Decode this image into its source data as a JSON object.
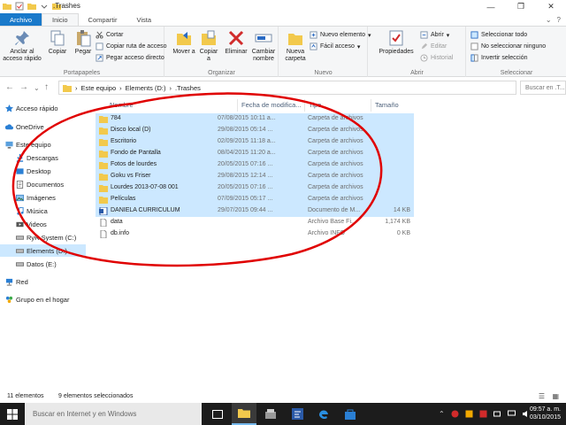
{
  "window": {
    "title": ".Trashes",
    "minimize": "—",
    "maximize": "❐",
    "close": "✕"
  },
  "tabs": [
    {
      "label": "Archivo"
    },
    {
      "label": "Inicio"
    },
    {
      "label": "Compartir"
    },
    {
      "label": "Vista"
    }
  ],
  "ribbon": {
    "clipboard": {
      "label": "Portapapeles",
      "pin": "Anclar al acceso rápido",
      "copy": "Copiar",
      "paste": "Pegar",
      "cut": "Cortar",
      "copy_path": "Copiar ruta de acceso",
      "paste_shortcut": "Pegar acceso directo"
    },
    "organize": {
      "label": "Organizar",
      "move_to": "Mover a",
      "copy_to": "Copiar a",
      "delete": "Eliminar",
      "rename": "Cambiar nombre"
    },
    "new": {
      "label": "Nuevo",
      "new_folder": "Nueva carpeta",
      "new_item": "Nuevo elemento",
      "easy_access": "Fácil acceso"
    },
    "open": {
      "label": "Abrir",
      "properties": "Propiedades",
      "open": "Abrir",
      "edit": "Editar",
      "history": "Historial"
    },
    "select": {
      "label": "Seleccionar",
      "select_all": "Seleccionar todo",
      "select_none": "No seleccionar ninguno",
      "invert": "Invertir selección"
    }
  },
  "address": {
    "crumbs": [
      "Este equipo",
      "Elements (D:)",
      ".Trashes"
    ],
    "search_placeholder": "Buscar en .T..."
  },
  "nav": [
    {
      "label": "Acceso rápido"
    },
    {
      "label": "OneDrive"
    },
    {
      "label": "Este equipo"
    },
    {
      "label": "Descargas"
    },
    {
      "label": "Desktop"
    },
    {
      "label": "Documentos"
    },
    {
      "label": "Imágenes"
    },
    {
      "label": "Música"
    },
    {
      "label": "Videos"
    },
    {
      "label": "RyR System (C:)"
    },
    {
      "label": "Elements (D:)"
    },
    {
      "label": "Datos (E:)"
    },
    {
      "label": "Red"
    },
    {
      "label": "Grupo en el hogar"
    }
  ],
  "columns": {
    "name": "Nombre",
    "date": "Fecha de modifica...",
    "type": "Tipo",
    "size": "Tamaño"
  },
  "files": [
    {
      "name": "784",
      "date": "07/08/2015 10:11 a...",
      "type": "Carpeta de archivos",
      "size": "",
      "kind": "folder",
      "selected": true
    },
    {
      "name": "Disco local (D)",
      "date": "29/08/2015 05:14 ...",
      "type": "Carpeta de archivos",
      "size": "",
      "kind": "folder",
      "selected": true
    },
    {
      "name": "Escritorio",
      "date": "02/09/2015 11:18 a...",
      "type": "Carpeta de archivos",
      "size": "",
      "kind": "folder",
      "selected": true
    },
    {
      "name": "Fondo de Pantalla",
      "date": "08/04/2015 11:20 a...",
      "type": "Carpeta de archivos",
      "size": "",
      "kind": "folder",
      "selected": true
    },
    {
      "name": "Fotos de lourdes",
      "date": "20/05/2015 07:16 ...",
      "type": "Carpeta de archivos",
      "size": "",
      "kind": "folder",
      "selected": true
    },
    {
      "name": "Goku vs Friser",
      "date": "29/08/2015 12:14 ...",
      "type": "Carpeta de archivos",
      "size": "",
      "kind": "folder",
      "selected": true
    },
    {
      "name": "Lourdes 2013-07-08 001",
      "date": "20/05/2015 07:16 ...",
      "type": "Carpeta de archivos",
      "size": "",
      "kind": "folder",
      "selected": true
    },
    {
      "name": "Películas",
      "date": "07/09/2015 05:17 ...",
      "type": "Carpeta de archivos",
      "size": "",
      "kind": "folder",
      "selected": true
    },
    {
      "name": "DANIELA CURRICULUM",
      "date": "29/07/2015 09:44 ...",
      "type": "Documento de M...",
      "size": "14 KB",
      "kind": "doc",
      "selected": true
    },
    {
      "name": "data",
      "date": "",
      "type": "Archivo Base Fi...",
      "size": "1,174 KB",
      "kind": "file",
      "selected": false
    },
    {
      "name": "db.info",
      "date": "",
      "type": "Archivo INFO",
      "size": "0 KB",
      "kind": "file",
      "selected": false
    }
  ],
  "status": {
    "count": "11 elementos",
    "selected": "9 elementos seleccionados"
  },
  "taskbar": {
    "search_placeholder": "Buscar en Internet y en Windows",
    "time": "09:57 a. m.",
    "date": "03/10/2015"
  },
  "colors": {
    "accent": "#1979ca",
    "selection": "#cce8ff",
    "annotation": "#e00000",
    "folder": "#f2c94c"
  }
}
